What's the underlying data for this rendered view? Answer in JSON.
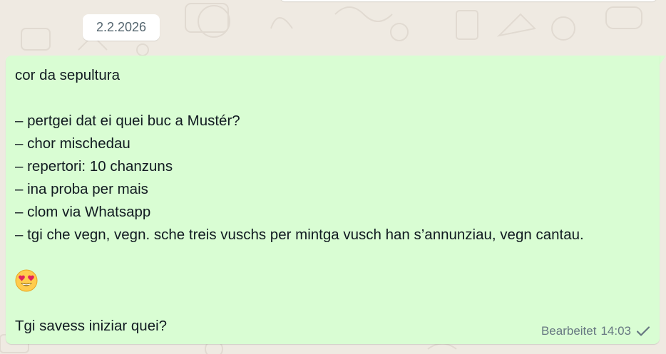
{
  "date_separator": "2.2.2026",
  "message": {
    "lines": {
      "l1": "cor da sepultura",
      "l2": "",
      "l3": "– pertgei dat ei quei buc a Mustér?",
      "l4": "– chor mischedau",
      "l5": "– repertori: 10 chanzuns",
      "l6": "– ina proba per mais",
      "l7": "– clom via Whatsapp",
      "l8": "– tgi che vegn, vegn. sche treis vuschs per mintga vusch han s’annunziau, vegn cantau.",
      "l9": "",
      "l11": "",
      "l12": "Tgi savess iniziar quei?"
    },
    "emoji": "smiling-face-with-heart-eyes",
    "edited_label": "Bearbeitet",
    "time": "14:03",
    "status_icon": "single-check-icon"
  },
  "colors": {
    "bubble_outgoing": "#d9fdd3",
    "background": "#efeae2",
    "meta_text": "#667781"
  }
}
